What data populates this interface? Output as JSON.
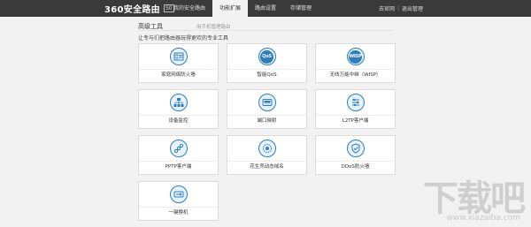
{
  "header": {
    "logo_text": "360安全路由",
    "logo_badge": "S0",
    "nav": [
      {
        "label": "我的安全路由",
        "active": false
      },
      {
        "label": "功能扩展",
        "active": true
      },
      {
        "label": "路由设置",
        "active": false
      },
      {
        "label": "存储管理",
        "active": false
      }
    ],
    "right_links": [
      "去官网",
      "退出管理"
    ],
    "right_sep": "|"
  },
  "section": {
    "title": "高级工具",
    "subtitle": "用手机管理路由",
    "description": "让专与们把路由器玩得更欢的专业工具"
  },
  "tools": [
    {
      "label": "家庭网络防火墙",
      "icon": "firewall-icon"
    },
    {
      "label": "智能QoS",
      "icon": "qos-icon",
      "icon_text": "QoS"
    },
    {
      "label": "无线万能中继（WISP）",
      "icon": "wisp-icon",
      "icon_text": "WISP"
    },
    {
      "label": "设备监控",
      "icon": "network-tree-icon"
    },
    {
      "label": "端口映射",
      "icon": "port-mapping-icon"
    },
    {
      "label": "L2TP客户端",
      "icon": "l2tp-icon"
    },
    {
      "label": "PPTP客户端",
      "icon": "pptp-icon"
    },
    {
      "label": "花生壳动态域名",
      "icon": "ddns-icon"
    },
    {
      "label": "DDoS防火墙",
      "icon": "ddos-icon"
    },
    {
      "label": "一键换机",
      "icon": "switch-device-icon"
    }
  ],
  "watermark": {
    "big": "下载吧",
    "small": "www.xiazaiba.com"
  },
  "colors": {
    "topbar": "#3a3a3a",
    "accent": "#2e7dbe",
    "page_bg": "#f2f2f2"
  }
}
